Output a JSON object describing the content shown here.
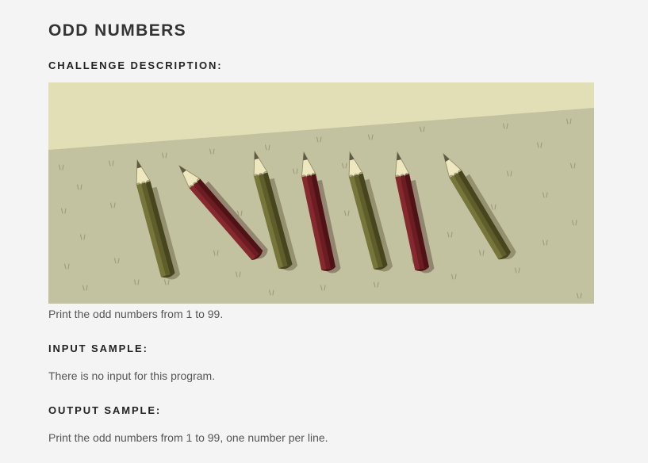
{
  "page": {
    "title": "ODD NUMBERS",
    "challenge_heading": "CHALLENGE DESCRIPTION:",
    "description": "Print the odd numbers from 1 to 99.",
    "input_heading": "INPUT SAMPLE:",
    "input_text": "There is no input for this program.",
    "output_heading": "OUTPUT SAMPLE:",
    "output_text": "Print the odd numbers from 1 to 99, one number per line."
  },
  "illustration": {
    "subject": "seven pencils leaning on grass",
    "pencil_colors": [
      "olive",
      "maroon",
      "olive",
      "maroon",
      "olive",
      "maroon",
      "olive"
    ],
    "colors": {
      "sky": "#e2dfb6",
      "grass": "#c2c1a0",
      "olive_pencil": "#5f5e2a",
      "maroon_pencil": "#6b1d22",
      "pencil_tip": "#efe7c0"
    }
  }
}
